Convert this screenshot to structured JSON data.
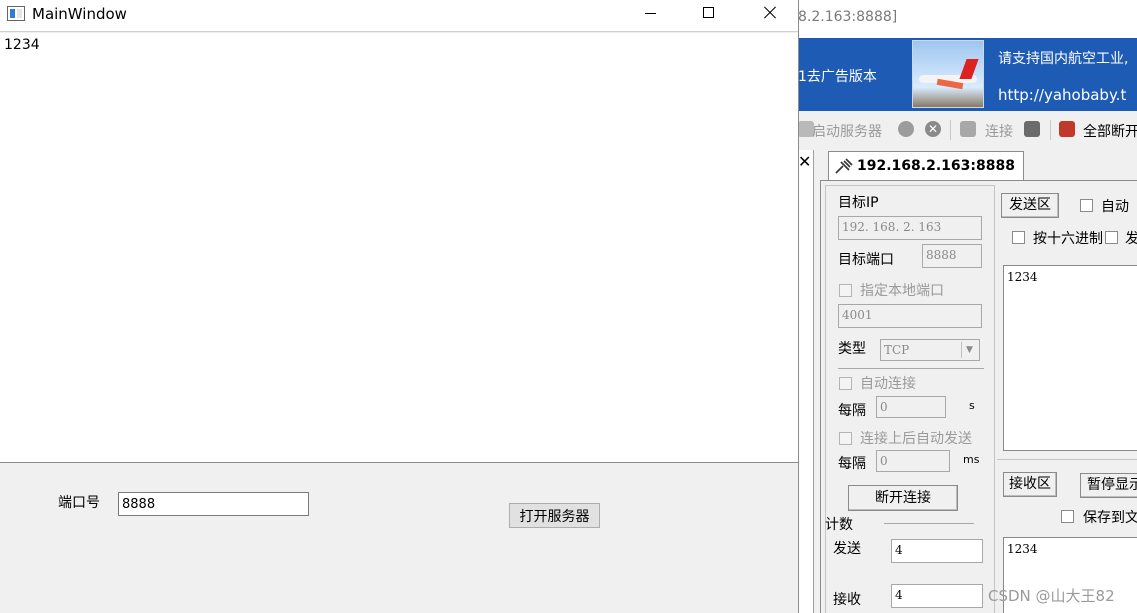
{
  "main_window": {
    "title": "MainWindow",
    "text_content": "1234",
    "port_label": "端口号",
    "port_value": "8888",
    "open_server_label": "打开服务器"
  },
  "tool_window": {
    "title_fragment": "8.2.163:8888]",
    "banner": {
      "ad_label": "1去广告版本",
      "support_text": "请支持国内航空工业,",
      "url": "http://yahobaby.t"
    },
    "toolbar": {
      "start_server": "启动服务器",
      "connect": "连接",
      "disconnect_all": "全部断开"
    },
    "close_glyph": "✕",
    "tab_label": "192.168.2.163:8888",
    "config": {
      "target_ip_label": "目标IP",
      "target_ip": "192. 168. 2. 163",
      "target_port_label": "目标端口",
      "target_port": "8888",
      "local_port_label": "指定本地端口",
      "local_port": "4001",
      "type_label": "类型",
      "type_value": "TCP",
      "auto_connect_label": "自动连接",
      "interval_label_1": "每隔",
      "interval_value_1": "0",
      "interval_unit_1": "s",
      "auto_send_label": "连接上后自动发送",
      "interval_label_2": "每隔",
      "interval_value_2": "0",
      "interval_unit_2": "ms",
      "disconnect_label": "断开连接",
      "count_label": "计数",
      "send_count_label": "发送",
      "send_count": "4",
      "recv_count_label": "接收",
      "recv_count": "4"
    },
    "send_area": {
      "label": "发送区",
      "auto_label": "自动",
      "hex_label": "按十六进制",
      "send_partial": "发",
      "content": "1234"
    },
    "recv_area": {
      "label": "接收区",
      "pause_label": "暂停显示",
      "save_label": "保存到文",
      "content": "1234"
    }
  },
  "watermark": "CSDN @山大王82"
}
